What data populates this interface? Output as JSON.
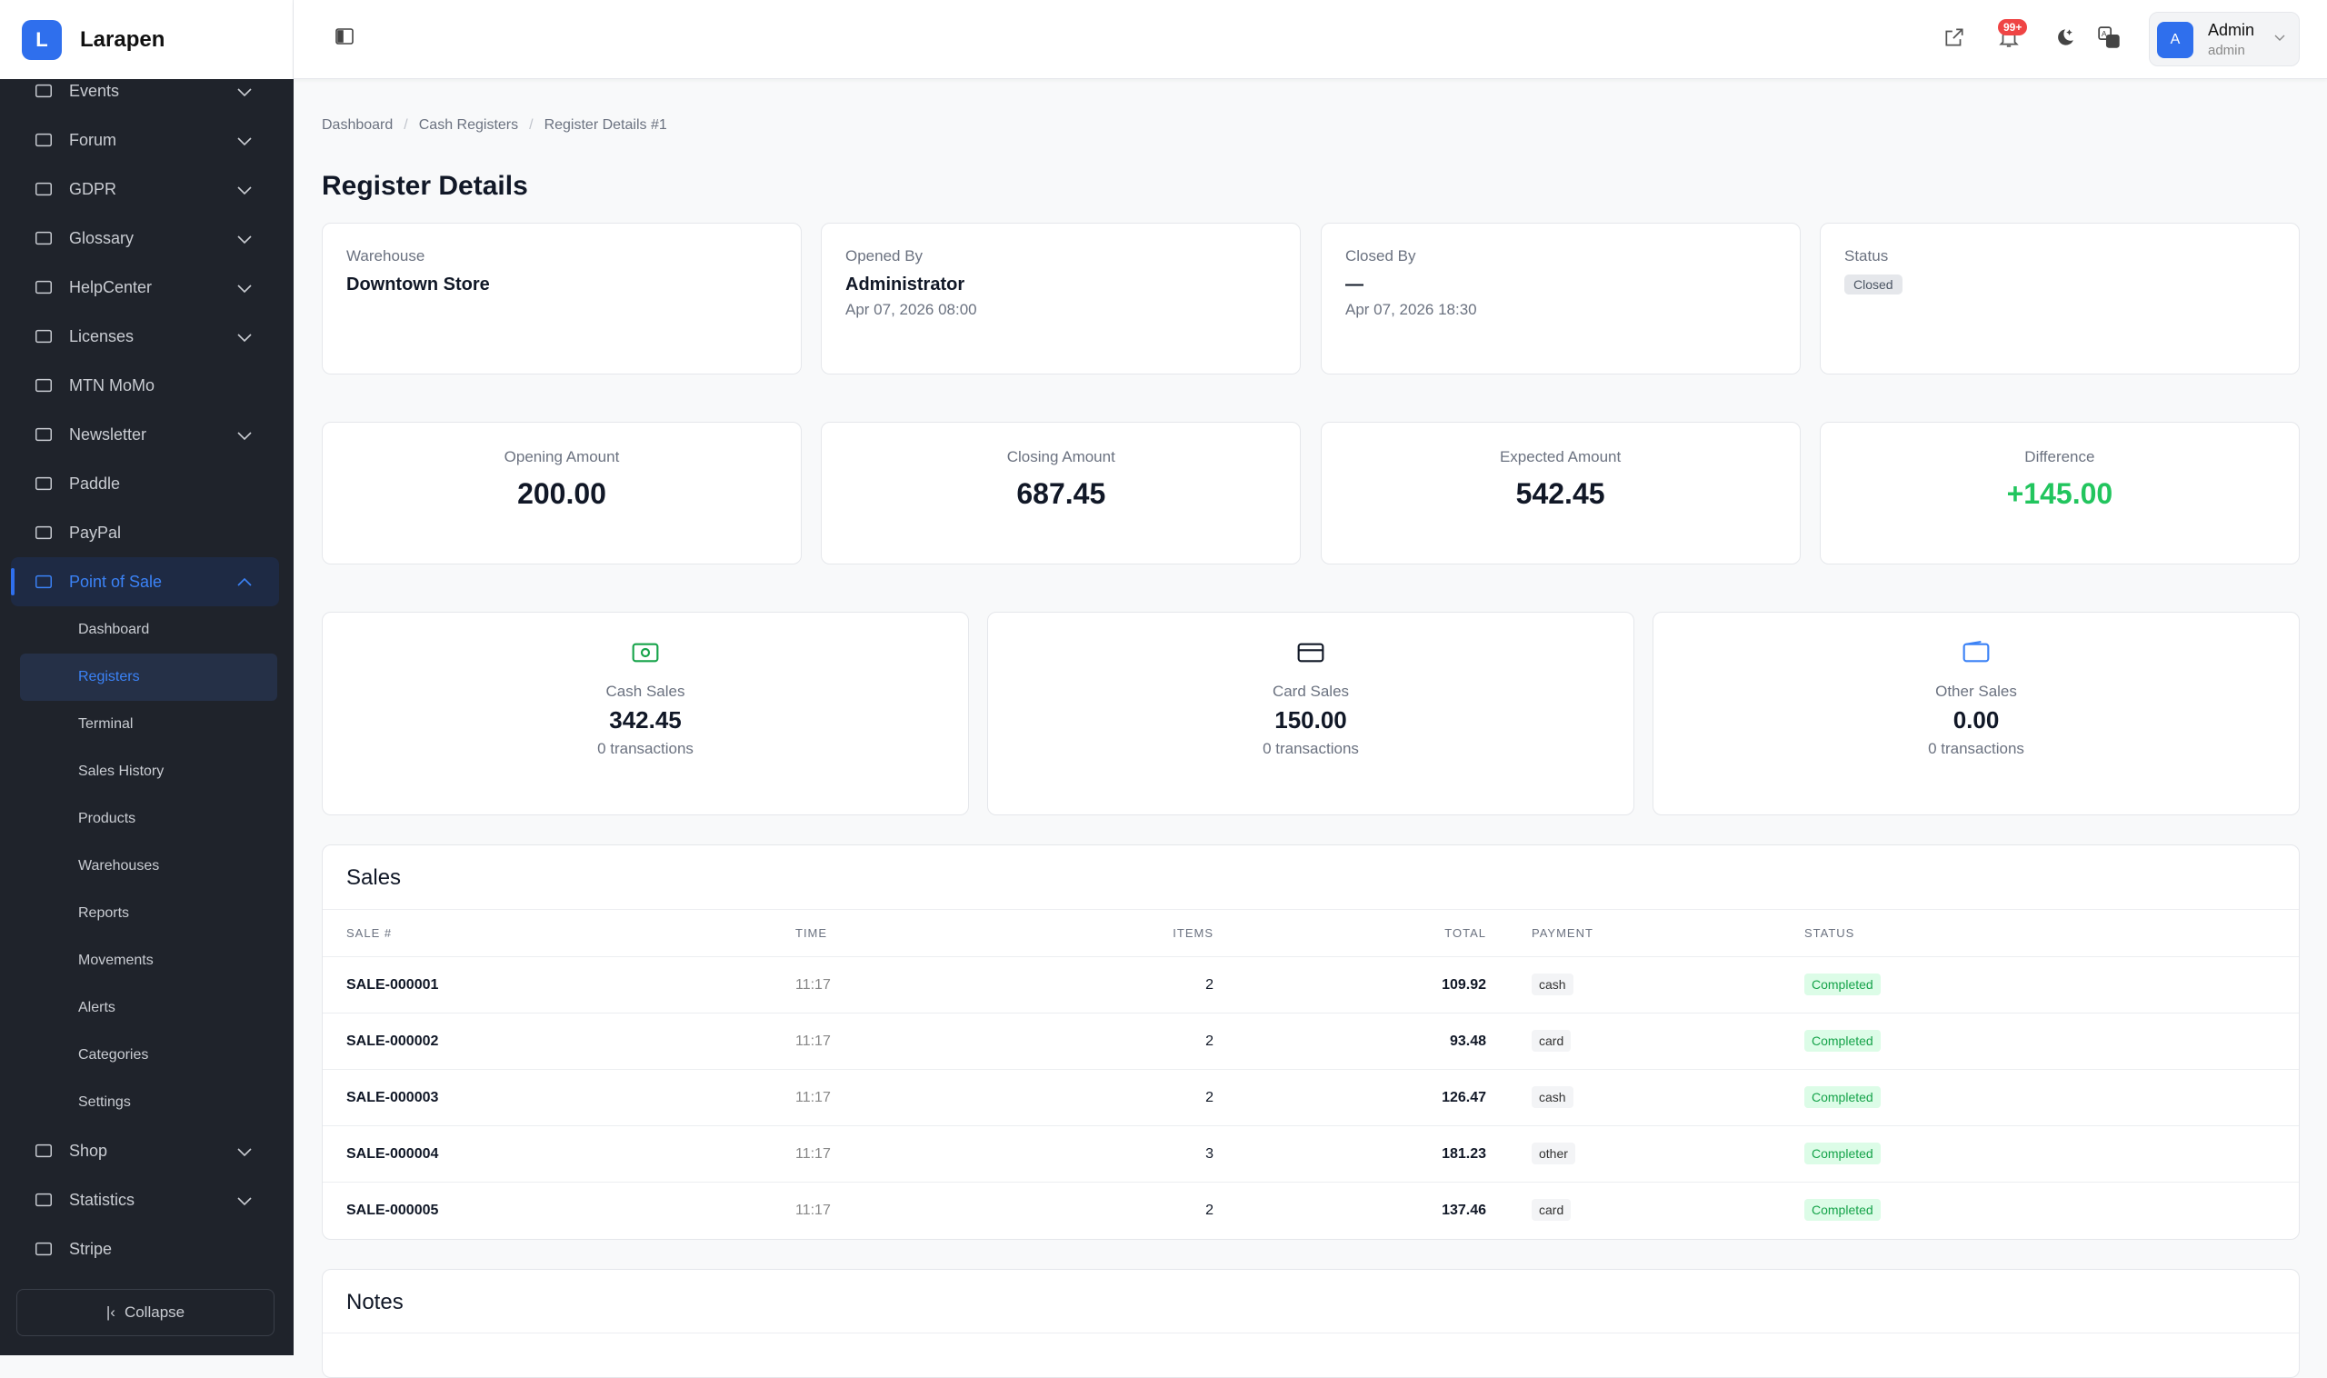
{
  "app": {
    "name": "Larapen",
    "logo_letter": "L"
  },
  "sidebar": {
    "items": [
      {
        "label": "Events",
        "icon": "calendar-icon",
        "chevron": true
      },
      {
        "label": "Forum",
        "icon": "chat-icon",
        "chevron": true
      },
      {
        "label": "GDPR",
        "icon": "shield-check-icon",
        "chevron": true
      },
      {
        "label": "Glossary",
        "icon": "book-icon",
        "chevron": true
      },
      {
        "label": "HelpCenter",
        "icon": "headset-icon",
        "chevron": true
      },
      {
        "label": "Licenses",
        "icon": "key-icon",
        "chevron": true
      },
      {
        "label": "MTN MoMo",
        "icon": "phone-icon",
        "chevron": false
      },
      {
        "label": "Newsletter",
        "icon": "envelope-icon",
        "chevron": true
      },
      {
        "label": "Paddle",
        "icon": "card-icon",
        "chevron": false
      },
      {
        "label": "PayPal",
        "icon": "paypal-icon",
        "chevron": false
      },
      {
        "label": "Point of Sale",
        "icon": "cubes-icon",
        "chevron": true,
        "active": true
      }
    ],
    "sub_items": [
      "Dashboard",
      "Registers",
      "Terminal",
      "Sales History",
      "Products",
      "Warehouses",
      "Reports",
      "Movements",
      "Alerts",
      "Categories",
      "Settings"
    ],
    "items_after": [
      {
        "label": "Shop",
        "icon": "store-icon",
        "chevron": true
      },
      {
        "label": "Statistics",
        "icon": "chart-icon",
        "chevron": true
      },
      {
        "label": "Stripe",
        "icon": "credit-card-icon",
        "chevron": false
      }
    ],
    "collapse_label": "Collapse"
  },
  "header": {
    "badge": "99+",
    "user_initial": "A",
    "user_name": "Admin",
    "user_role": "admin"
  },
  "breadcrumb": [
    "Dashboard",
    "Cash Registers",
    "Register Details #1"
  ],
  "page_title": "Register Details",
  "info": {
    "warehouse_label": "Warehouse",
    "warehouse": "Downtown Store",
    "opened_label": "Opened By",
    "opened_by": "Administrator",
    "opened_at": "Apr 07, 2026 08:00",
    "closed_label": "Closed By",
    "closed_by": "—",
    "closed_at": "Apr 07, 2026 18:30",
    "status_label": "Status",
    "status": "Closed"
  },
  "amounts": [
    {
      "label": "Opening Amount",
      "value": "200.00"
    },
    {
      "label": "Closing Amount",
      "value": "687.45"
    },
    {
      "label": "Expected Amount",
      "value": "542.45"
    },
    {
      "label": "Difference",
      "value": "+145.00"
    }
  ],
  "sales_summary": [
    {
      "label": "Cash Sales",
      "value": "342.45",
      "sub": "0 transactions",
      "color": "#16a34a"
    },
    {
      "label": "Card Sales",
      "value": "150.00",
      "sub": "0 transactions",
      "color": "#111827"
    },
    {
      "label": "Other Sales",
      "value": "0.00",
      "sub": "0 transactions",
      "color": "#3b82f6"
    }
  ],
  "sales": {
    "title": "Sales",
    "columns": [
      "SALE #",
      "TIME",
      "ITEMS",
      "TOTAL",
      "PAYMENT",
      "STATUS"
    ],
    "rows": [
      [
        "SALE-000001",
        "11:17",
        "2",
        "109.92",
        "cash",
        "Completed"
      ],
      [
        "SALE-000002",
        "11:17",
        "2",
        "93.48",
        "card",
        "Completed"
      ],
      [
        "SALE-000003",
        "11:17",
        "2",
        "126.47",
        "cash",
        "Completed"
      ],
      [
        "SALE-000004",
        "11:17",
        "3",
        "181.23",
        "other",
        "Completed"
      ],
      [
        "SALE-000005",
        "11:17",
        "2",
        "137.46",
        "card",
        "Completed"
      ]
    ]
  },
  "notes": {
    "title": "Notes"
  }
}
